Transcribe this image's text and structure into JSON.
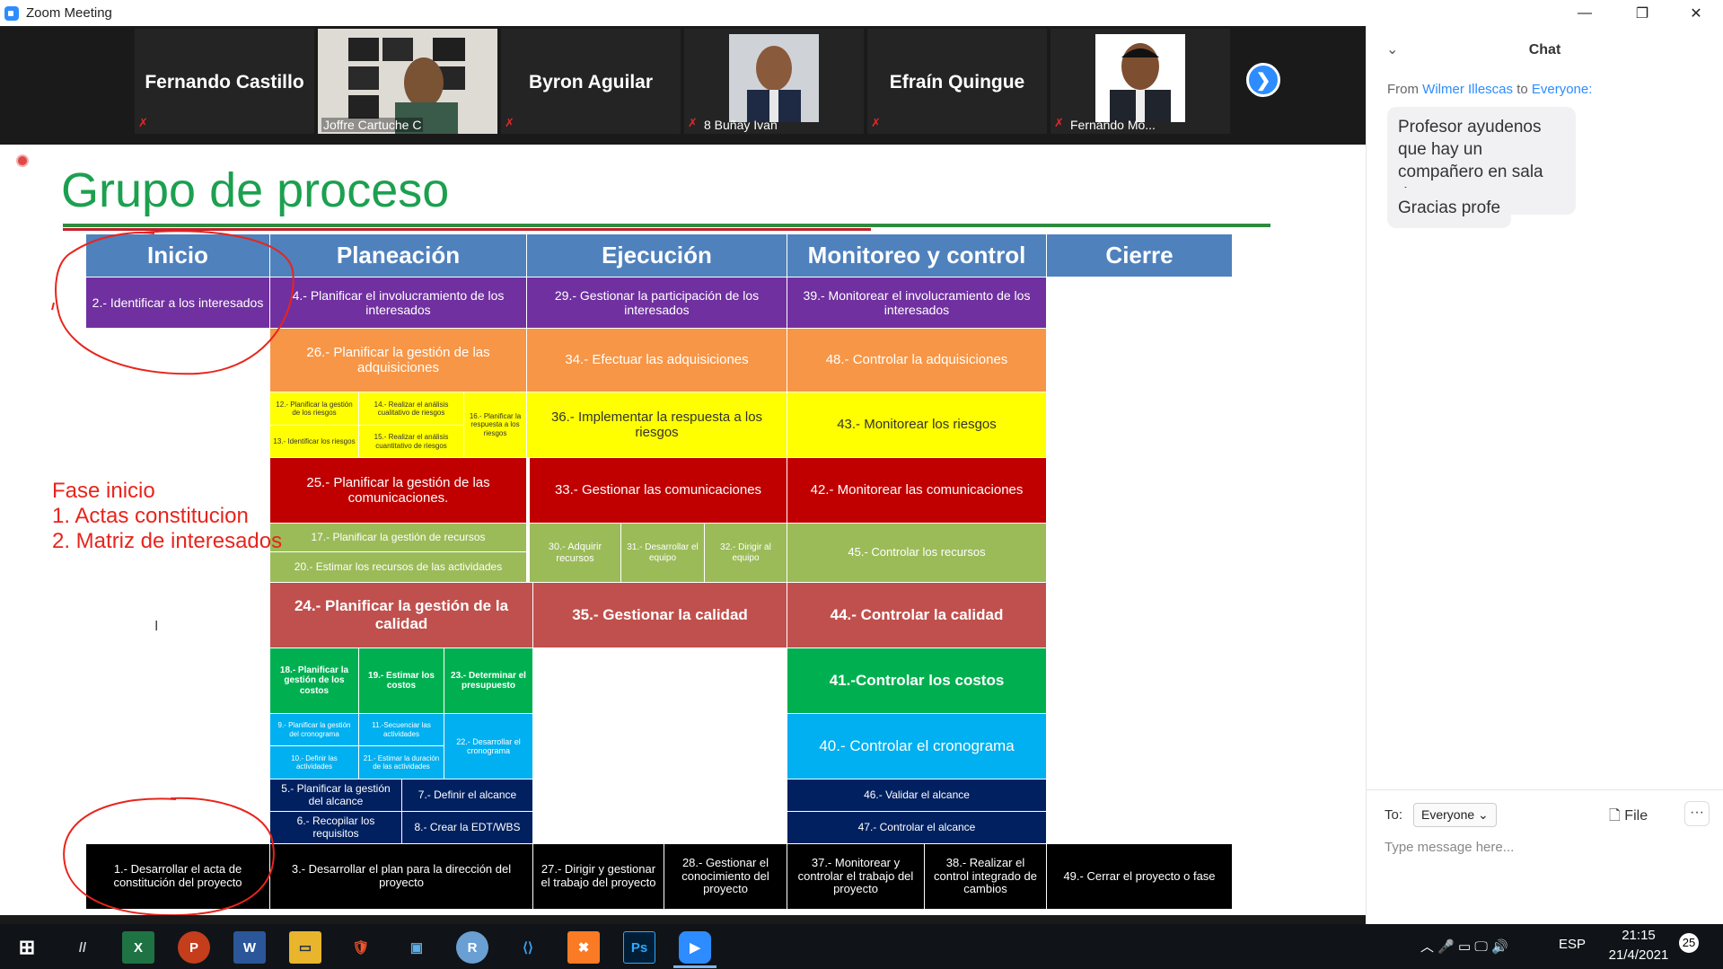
{
  "window": {
    "title": "Zoom Meeting",
    "min": "—",
    "restore": "❐",
    "close": "✕"
  },
  "participants": [
    {
      "name": "Fernando Castillo"
    },
    {
      "label": "Joffre Cartuche C"
    },
    {
      "name": "Byron Aguilar"
    },
    {
      "label": "8 Buñay Ivan"
    },
    {
      "name": "Efraín Quingue"
    },
    {
      "label": "Fernando Mo..."
    }
  ],
  "next_arrow": "❯",
  "mute_glyph": "✗",
  "slide": {
    "title": "Grupo de proceso",
    "headers": [
      "Inicio",
      "Planeación",
      "Ejecución",
      "Monitoreo y control",
      "Cierre"
    ],
    "cells": {
      "c2": "2.- Identificar a los interesados",
      "c4": "4.- Planificar el involucramiento de los interesados",
      "c29": "29.- Gestionar la participación de los interesados",
      "c39": "39.- Monitorear el involucramiento de los interesados",
      "c26": "26.- Planificar la gestión de las adquisiciones",
      "c34": "34.- Efectuar las adquisiciones",
      "c48": "48.- Controlar la adquisiciones",
      "c12": "12.- Planificar la gestión de los riesgos",
      "c14": "14.- Realizar el análisis cualitativo de riesgos",
      "c16": "16.- Planificar la respuesta a los riesgos",
      "c13": "13.- Identificar los riesgos",
      "c15": "15.- Realizar el análisis cuantitativo de riesgos",
      "c36": "36.- Implementar la respuesta a los riesgos",
      "c43": "43.- Monitorear los riesgos",
      "c25": "25.- Planificar la gestión de las comunicaciones.",
      "c33": "33.- Gestionar las comunicaciones",
      "c42": "42.- Monitorear las comunicaciones",
      "c17": "17.- Planificar la gestión de recursos",
      "c20": "20.- Estimar los recursos de las actividades",
      "c30": "30.- Adquirir recursos",
      "c31": "31.- Desarrollar el equipo",
      "c32": "32.- Dirigir al equipo",
      "c45": "45.- Controlar los recursos",
      "c24": "24.- Planificar la gestión de la calidad",
      "c35": "35.- Gestionar la calidad",
      "c44": "44.- Controlar la calidad",
      "c18": "18.- Planificar la gestión de los costos",
      "c19": "19.- Estimar los costos",
      "c23": "23.- Determinar el presupuesto",
      "c41": "41.-Controlar los costos",
      "c9": "9.- Planificar la gestión del cronograma",
      "c11": "11.-Secuenciar las actividades",
      "c22": "22.- Desarrollar el cronograma",
      "c10": "10.- Definir las actividades",
      "c21": "21.- Estimar la duración de las actividades",
      "c40": "40.- Controlar el cronograma",
      "c5": "5.- Planificar la gestión del alcance",
      "c7": "7.- Definir el alcance",
      "c46": "46.- Validar el alcance",
      "c6": "6.- Recopilar los requisitos",
      "c8": "8.- Crear la EDT/WBS",
      "c47": "47.- Controlar el alcance",
      "c1": "1.- Desarrollar el acta de constitución del proyecto",
      "c3": "3.- Desarrollar el plan para la dirección del proyecto",
      "c27": "27.- Dirigir y gestionar el trabajo del proyecto",
      "c28": "28.- Gestionar el conocimiento del proyecto",
      "c37": "37.- Monitorear y controlar el trabajo del proyecto",
      "c38": "38.- Realizar el control integrado de cambios",
      "c49": "49.- Cerrar el proyecto o fase"
    },
    "notes": [
      "Fase inicio",
      "1. Actas constitucion",
      "2. Matriz de interesados"
    ],
    "cursor": "I"
  },
  "chat": {
    "title": "Chat",
    "collapse_icon": "⌄",
    "from_prefix": "From",
    "from_sender": "Wilmer Illescas",
    "from_mid": "to",
    "from_target": "Everyone:",
    "messages": [
      "Profesor ayudenos que hay un compañero en sala de espera",
      "Gracias profe"
    ],
    "to_label": "To:",
    "to_value": "Everyone ⌄",
    "file_label": "🗋  File",
    "more": "···",
    "placeholder": "Type message here..."
  },
  "taskbar": {
    "apps": [
      "⊞",
      "//",
      "X",
      "P",
      "W",
      "▭",
      "🛡",
      "▣",
      "R",
      "⟨⟩",
      "✖",
      "Ps",
      "▶"
    ],
    "tray_lang": "ESP",
    "time": "21:15",
    "date": "21/4/2021",
    "notif_count": "25"
  }
}
